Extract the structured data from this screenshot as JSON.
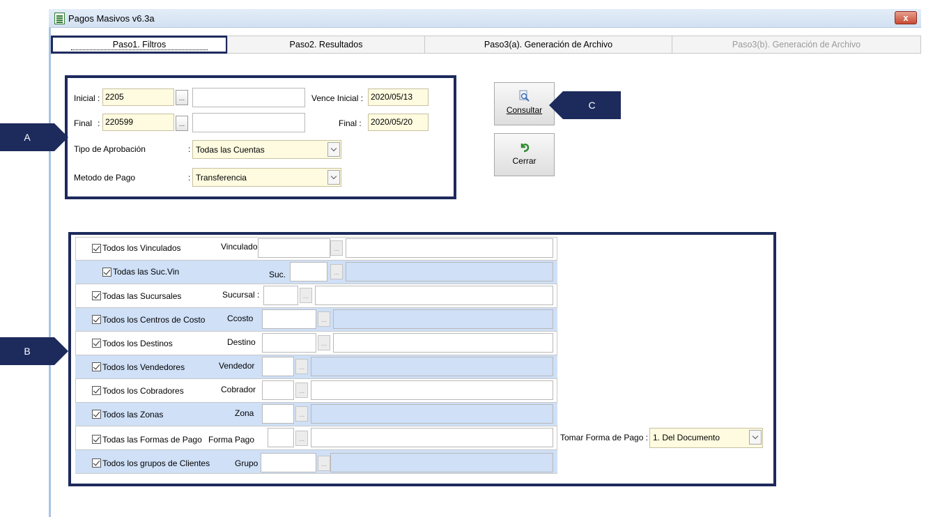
{
  "window": {
    "title": "Pagos Masivos v6.3a",
    "close_label": "x"
  },
  "tabs": [
    {
      "label": "Paso1. Filtros"
    },
    {
      "label": "Paso2. Resultados"
    },
    {
      "label": "Paso3(a). Generación de Archivo"
    },
    {
      "label": "Paso3(b). Generación de Archivo"
    }
  ],
  "callouts": {
    "a": "A",
    "b": "B",
    "c": "C"
  },
  "filters": {
    "inicial_label": "Inicial",
    "inicial_value": "2205",
    "final_label": "Final",
    "final_value": "220599",
    "vence_inicial_label": "Vence Inicial :",
    "vence_inicial_value": "2020/05/13",
    "vence_final_label": "Final :",
    "vence_final_value": "2020/05/20",
    "tipo_aprobacion_label": "Tipo de Aprobación",
    "tipo_aprobacion_value": "Todas las Cuentas",
    "metodo_pago_label": "Metodo de Pago",
    "metodo_pago_value": "Transferencia",
    "colon": ":",
    "ellipsis": "..."
  },
  "buttons": {
    "consultar": "Consultar",
    "cerrar": "Cerrar"
  },
  "groups": [
    {
      "check": "Todos los Vinculados",
      "field": "Vinculado"
    },
    {
      "check": "Todas las Suc.Vin",
      "field": "Suc."
    },
    {
      "check": "Todas las Sucursales",
      "field": "Sucursal :"
    },
    {
      "check": "Todos los Centros de Costo",
      "field": "Ccosto"
    },
    {
      "check": "Todos los Destinos",
      "field": "Destino"
    },
    {
      "check": "Todos los Vendedores",
      "field": "Vendedor"
    },
    {
      "check": "Todos los Cobradores",
      "field": "Cobrador"
    },
    {
      "check": "Todos las Zonas",
      "field": "Zona"
    },
    {
      "check": "Todas las Formas de Pago",
      "field": "Forma Pago"
    },
    {
      "check": "Todos los grupos de Clientes",
      "field": "Grupo"
    }
  ],
  "forma_pago": {
    "label": "Tomar Forma de Pago :",
    "value": "1. Del Documento"
  }
}
